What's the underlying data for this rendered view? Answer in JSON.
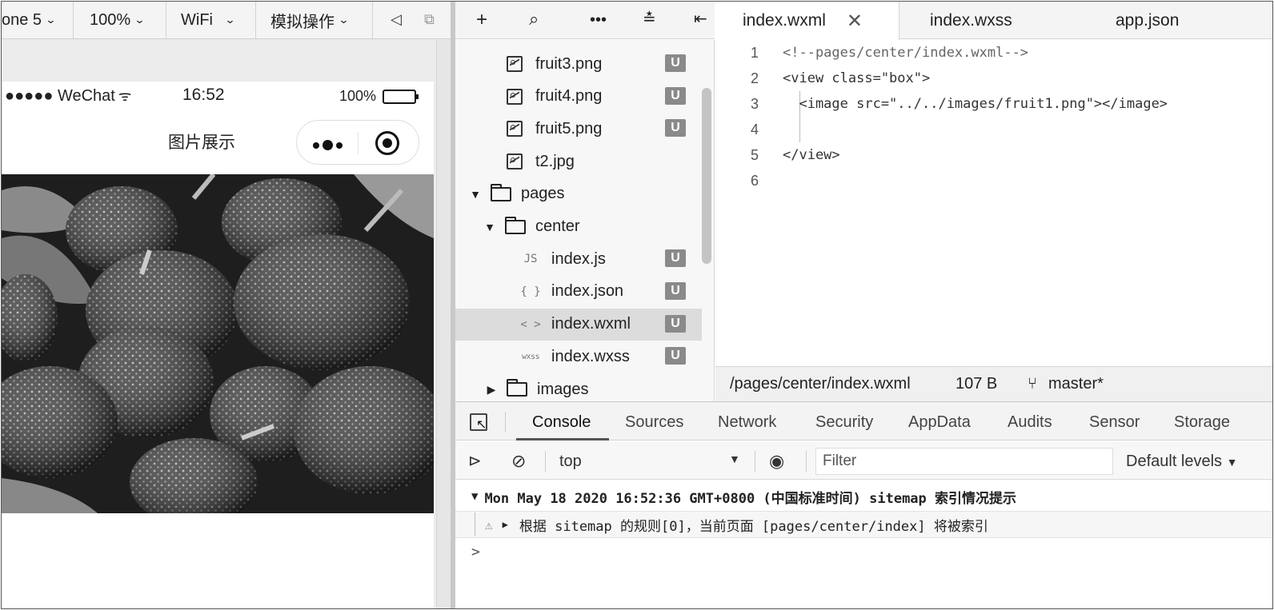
{
  "simulator": {
    "toolbar": {
      "device": "one 5",
      "zoom": "100%",
      "network": "WiFi",
      "operation": "模拟操作"
    },
    "status_bar": {
      "carrier": "●●●●● WeChat",
      "time": "16:52",
      "battery_text": "100%",
      "battery_level": 1.0
    },
    "nav_title": "图片展示"
  },
  "file_tree": {
    "rows": [
      {
        "name": "fruit3.png",
        "kind": "image",
        "badge": "U"
      },
      {
        "name": "fruit4.png",
        "kind": "image",
        "badge": "U"
      },
      {
        "name": "fruit5.png",
        "kind": "image",
        "badge": "U"
      },
      {
        "name": "t2.jpg",
        "kind": "image",
        "badge": ""
      },
      {
        "name": "pages",
        "kind": "folder-open",
        "badge": ""
      },
      {
        "name": "center",
        "kind": "folder-open",
        "badge": ""
      },
      {
        "name": "index.js",
        "kind": "js",
        "icon_text": "JS",
        "badge": "U"
      },
      {
        "name": "index.json",
        "kind": "json",
        "icon_text": "{ }",
        "badge": "U"
      },
      {
        "name": "index.wxml",
        "kind": "wxml",
        "icon_text": "< >",
        "badge": "U",
        "selected": true
      },
      {
        "name": "index.wxss",
        "kind": "wxss",
        "icon_text": "wxss",
        "badge": "U"
      },
      {
        "name": "images",
        "kind": "folder-closed",
        "badge": ""
      }
    ]
  },
  "editor": {
    "tabs": [
      {
        "label": "index.wxml",
        "active": true
      },
      {
        "label": "index.wxss",
        "active": false
      },
      {
        "label": "app.json",
        "active": false
      }
    ],
    "close_glyph": "✕",
    "lines": [
      {
        "n": "1",
        "text": "<!--pages/center/index.wxml-->"
      },
      {
        "n": "2",
        "text": "<view class=\"box\">"
      },
      {
        "n": "3",
        "text": "  <image src=\"../../images/fruit1.png\"></image>"
      },
      {
        "n": "4",
        "text": ""
      },
      {
        "n": "5",
        "text": "</view>"
      },
      {
        "n": "6",
        "text": ""
      }
    ],
    "status": {
      "path": "/pages/center/index.wxml",
      "size": "107 B",
      "branch": "master*"
    }
  },
  "devtools": {
    "tabs": [
      "Console",
      "Sources",
      "Network",
      "Security",
      "AppData",
      "Audits",
      "Sensor",
      "Storage"
    ],
    "active_tab": "Console",
    "context": "top",
    "filter_placeholder": "Filter",
    "levels": "Default levels",
    "messages": {
      "group": "Mon May 18 2020 16:52:36 GMT+0800 (中国标准时间) sitemap 索引情况提示",
      "warning": "根据 sitemap 的规则[0]，当前页面 [pages/center/index] 将被索引"
    },
    "prompt": ">"
  }
}
